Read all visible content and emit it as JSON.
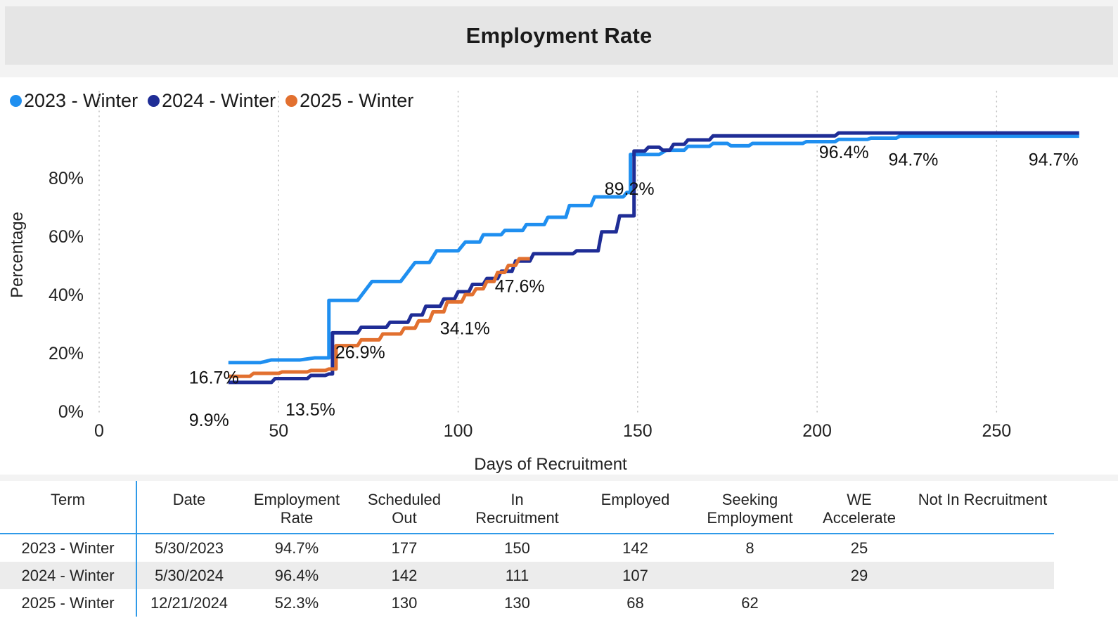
{
  "header": {
    "title": "Employment Rate"
  },
  "legend": {
    "items": [
      {
        "label": "2023 - Winter",
        "color": "#1f8ff0"
      },
      {
        "label": "2024 - Winter",
        "color": "#1f2d96"
      },
      {
        "label": "2025 - Winter",
        "color": "#e2702f"
      }
    ]
  },
  "chart_data": {
    "type": "line",
    "title": "Employment Rate",
    "xlabel": "Days of Recruitment",
    "ylabel": "Percentage",
    "xlim": [
      0,
      275
    ],
    "ylim": [
      0,
      100
    ],
    "xticks": [
      0,
      50,
      100,
      150,
      200,
      250
    ],
    "xticklabels": [
      "0",
      "50",
      "100",
      "150",
      "200",
      "250"
    ],
    "yticks": [
      0,
      20,
      40,
      60,
      80
    ],
    "yticklabels": [
      "0%",
      "20%",
      "40%",
      "60%",
      "80%"
    ],
    "grid": "vertical-dotted",
    "legend_position": "top-left",
    "series": [
      {
        "name": "2023 - Winter",
        "color": "#1f8ff0",
        "points": [
          [
            36,
            16.7
          ],
          [
            45,
            16.7
          ],
          [
            48,
            17.6
          ],
          [
            56,
            17.6
          ],
          [
            60,
            18.3
          ],
          [
            64,
            18.3
          ],
          [
            64,
            38.0
          ],
          [
            72,
            38.0
          ],
          [
            76,
            44.5
          ],
          [
            84,
            44.5
          ],
          [
            88,
            51.0
          ],
          [
            92,
            51.0
          ],
          [
            94,
            55.0
          ],
          [
            100,
            55.0
          ],
          [
            102,
            58.0
          ],
          [
            106,
            58.0
          ],
          [
            107,
            60.5
          ],
          [
            112,
            60.5
          ],
          [
            113,
            62.0
          ],
          [
            118,
            62.0
          ],
          [
            119,
            64.0
          ],
          [
            124,
            64.0
          ],
          [
            125,
            66.5
          ],
          [
            130,
            66.5
          ],
          [
            131,
            70.5
          ],
          [
            137,
            70.5
          ],
          [
            138,
            73.5
          ],
          [
            146,
            73.5
          ],
          [
            147,
            75.0
          ],
          [
            148,
            75.0
          ],
          [
            148,
            88.0
          ],
          [
            156,
            88.0
          ],
          [
            158,
            89.5
          ],
          [
            163,
            89.5
          ],
          [
            164,
            90.8
          ],
          [
            170,
            90.8
          ],
          [
            171,
            91.8
          ],
          [
            175,
            91.8
          ],
          [
            176,
            91.0
          ],
          [
            181,
            91.0
          ],
          [
            182,
            91.8
          ],
          [
            196,
            91.8
          ],
          [
            197,
            92.4
          ],
          [
            205,
            92.4
          ],
          [
            206,
            93.2
          ],
          [
            214,
            93.2
          ],
          [
            215,
            93.6
          ],
          [
            222,
            93.6
          ],
          [
            223,
            94.3
          ],
          [
            273,
            94.3
          ]
        ],
        "end_label": "94.7%",
        "labels": [
          "16.7%",
          "89.2%",
          "94.7%"
        ]
      },
      {
        "name": "2024 - Winter",
        "color": "#1f2d96",
        "points": [
          [
            36,
            9.9
          ],
          [
            48,
            9.9
          ],
          [
            49,
            11.2
          ],
          [
            58,
            11.2
          ],
          [
            59,
            12.3
          ],
          [
            63,
            12.3
          ],
          [
            64,
            12.8
          ],
          [
            65,
            12.8
          ],
          [
            65,
            26.9
          ],
          [
            72,
            26.9
          ],
          [
            73,
            28.8
          ],
          [
            80,
            28.8
          ],
          [
            81,
            30.5
          ],
          [
            86,
            30.5
          ],
          [
            87,
            33.0
          ],
          [
            90,
            33.0
          ],
          [
            91,
            36.0
          ],
          [
            95,
            36.0
          ],
          [
            96,
            38.5
          ],
          [
            99,
            38.5
          ],
          [
            100,
            41.0
          ],
          [
            103,
            41.0
          ],
          [
            104,
            43.5
          ],
          [
            107,
            43.5
          ],
          [
            108,
            45.5
          ],
          [
            111,
            45.5
          ],
          [
            112,
            48.0
          ],
          [
            115,
            48.0
          ],
          [
            116,
            51.5
          ],
          [
            120,
            51.5
          ],
          [
            121,
            54.0
          ],
          [
            132,
            54.0
          ],
          [
            133,
            55.0
          ],
          [
            139,
            55.0
          ],
          [
            140,
            61.5
          ],
          [
            144,
            61.5
          ],
          [
            145,
            67.0
          ],
          [
            149,
            67.0
          ],
          [
            149,
            89.2
          ],
          [
            152,
            89.2
          ],
          [
            153,
            90.5
          ],
          [
            156,
            90.5
          ],
          [
            157,
            89.5
          ],
          [
            159,
            89.5
          ],
          [
            160,
            91.5
          ],
          [
            163,
            91.5
          ],
          [
            164,
            93.0
          ],
          [
            170,
            93.0
          ],
          [
            171,
            94.4
          ],
          [
            205,
            94.4
          ],
          [
            206,
            95.4
          ],
          [
            273,
            95.4
          ]
        ],
        "end_label": "96.4%",
        "labels": [
          "9.9%",
          "26.9%",
          "89.2%",
          "96.4%"
        ]
      },
      {
        "name": "2025 - Winter",
        "color": "#e2702f",
        "points": [
          [
            36,
            12.0
          ],
          [
            42,
            12.0
          ],
          [
            43,
            13.0
          ],
          [
            50,
            13.0
          ],
          [
            51,
            13.5
          ],
          [
            58,
            13.5
          ],
          [
            59,
            14.0
          ],
          [
            63,
            14.0
          ],
          [
            64,
            14.5
          ],
          [
            66,
            14.5
          ],
          [
            66,
            22.5
          ],
          [
            72,
            22.5
          ],
          [
            73,
            24.5
          ],
          [
            78,
            24.5
          ],
          [
            79,
            26.5
          ],
          [
            84,
            26.5
          ],
          [
            85,
            28.5
          ],
          [
            88,
            28.5
          ],
          [
            89,
            31.0
          ],
          [
            92,
            31.0
          ],
          [
            93,
            34.1
          ],
          [
            96,
            34.1
          ],
          [
            97,
            37.5
          ],
          [
            101,
            37.5
          ],
          [
            102,
            40.0
          ],
          [
            104,
            40.0
          ],
          [
            105,
            42.0
          ],
          [
            107,
            42.0
          ],
          [
            108,
            44.5
          ],
          [
            110,
            44.5
          ],
          [
            111,
            47.6
          ],
          [
            113,
            47.6
          ],
          [
            114,
            50.0
          ],
          [
            116,
            50.0
          ],
          [
            117,
            52.3
          ],
          [
            120,
            52.3
          ]
        ],
        "end_label": "52.3%",
        "labels": [
          "13.5%",
          "34.1%",
          "47.6%"
        ]
      }
    ],
    "annotations": [
      {
        "text": "16.7%",
        "x": 36,
        "y": 16.7,
        "dx": -56,
        "dy": 30
      },
      {
        "text": "9.9%",
        "x": 36,
        "y": 9.9,
        "dx": -56,
        "dy": 62
      },
      {
        "text": "13.5%",
        "x": 57,
        "y": 13.5,
        "dx": -26,
        "dy": 62
      },
      {
        "text": "26.9%",
        "x": 65,
        "y": 26.9,
        "dx": 4,
        "dy": 36
      },
      {
        "text": "34.1%",
        "x": 93,
        "y": 34.1,
        "dx": 10,
        "dy": 32
      },
      {
        "text": "47.6%",
        "x": 111,
        "y": 47.6,
        "dx": -4,
        "dy": 28
      },
      {
        "text": "89.2%",
        "x": 149,
        "y": 89.2,
        "dx": -42,
        "dy": 62
      },
      {
        "text": "96.4%",
        "x": 206,
        "y": 95.4,
        "dx": -28,
        "dy": 36
      },
      {
        "text": "94.7%",
        "x": 223,
        "y": 94.3,
        "dx": -16,
        "dy": 42
      },
      {
        "text": "94.7%",
        "x": 273,
        "y": 94.3,
        "dx": -72,
        "dy": 42
      }
    ]
  },
  "table": {
    "columns": [
      "Term",
      "Date",
      "Employment Rate",
      "Scheduled Out",
      "In Recruitment",
      "Employed",
      "Seeking Employment",
      "WE Accelerate",
      "Not In Recruitment"
    ],
    "column_lines": [
      [
        "Term",
        ""
      ],
      [
        "Date",
        ""
      ],
      [
        "Employment",
        "Rate"
      ],
      [
        "Scheduled",
        "Out"
      ],
      [
        "In",
        "Recruitment"
      ],
      [
        "Employed",
        ""
      ],
      [
        "Seeking",
        "Employment"
      ],
      [
        "WE",
        "Accelerate"
      ],
      [
        "Not In Recruitment",
        ""
      ]
    ],
    "rows": [
      {
        "term": "2023 - Winter",
        "date": "5/30/2023",
        "employment_rate": "94.7%",
        "scheduled_out": "177",
        "in_recruitment": "150",
        "employed": "142",
        "seeking_employment": "8",
        "we_accelerate": "25",
        "not_in_recruitment": ""
      },
      {
        "term": "2024 - Winter",
        "date": "5/30/2024",
        "employment_rate": "96.4%",
        "scheduled_out": "142",
        "in_recruitment": "111",
        "employed": "107",
        "seeking_employment": "",
        "we_accelerate": "29",
        "not_in_recruitment": ""
      },
      {
        "term": "2025 - Winter",
        "date": "12/21/2024",
        "employment_rate": "52.3%",
        "scheduled_out": "130",
        "in_recruitment": "130",
        "employed": "68",
        "seeking_employment": "62",
        "we_accelerate": "",
        "not_in_recruitment": ""
      }
    ]
  },
  "colors": {
    "accent_blue": "#2f9ae8",
    "series_2023": "#1f8ff0",
    "series_2024": "#1f2d96",
    "series_2025": "#e2702f",
    "header_band": "#e5e5e5",
    "page_bg": "#f3f3f3",
    "row_alt": "#ececec"
  }
}
